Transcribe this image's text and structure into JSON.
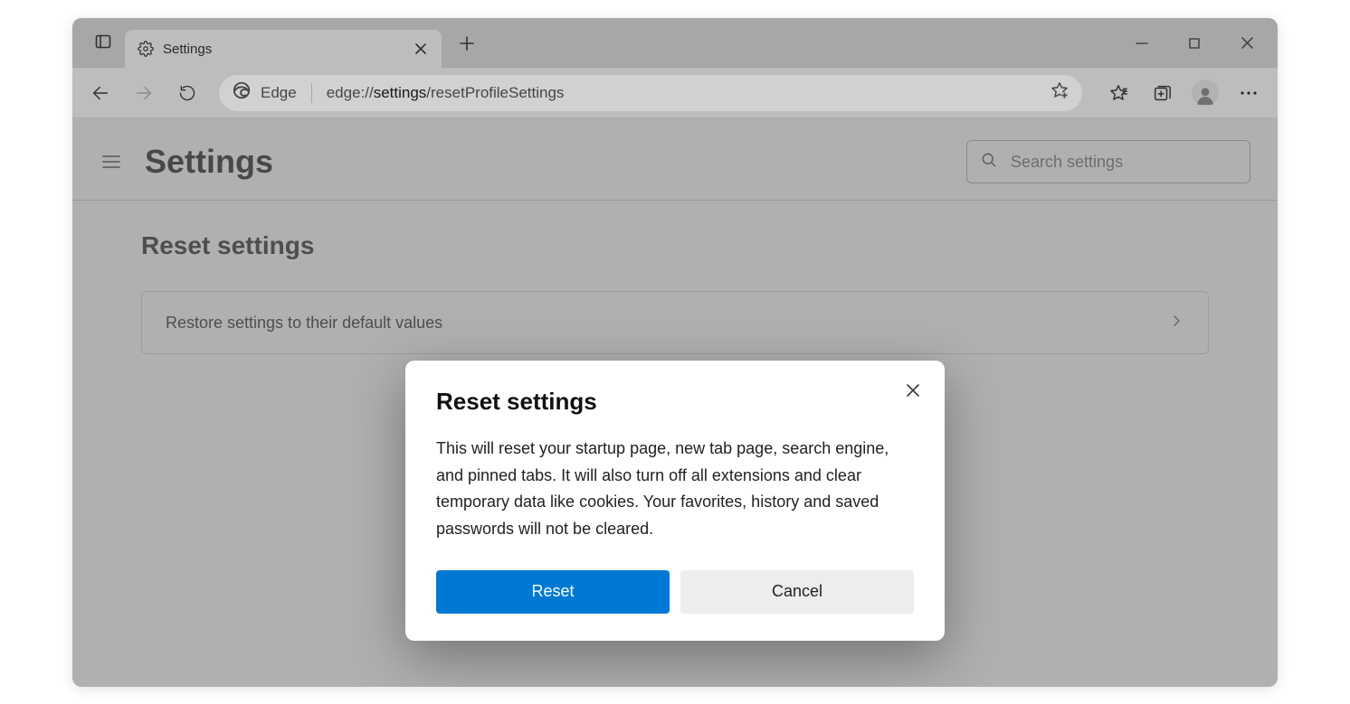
{
  "tab": {
    "title": "Settings"
  },
  "omnibox": {
    "brand": "Edge",
    "url_prefix": "edge://",
    "url_mid": "settings",
    "url_suffix": "/resetProfileSettings"
  },
  "settings": {
    "title": "Settings",
    "search_placeholder": "Search settings",
    "section_title": "Reset settings",
    "row_label": "Restore settings to their default values"
  },
  "dialog": {
    "title": "Reset settings",
    "body": "This will reset your startup page, new tab page, search engine, and pinned tabs. It will also turn off all extensions and clear temporary data like cookies. Your favorites, history and saved passwords will not be cleared.",
    "primary": "Reset",
    "secondary": "Cancel"
  }
}
